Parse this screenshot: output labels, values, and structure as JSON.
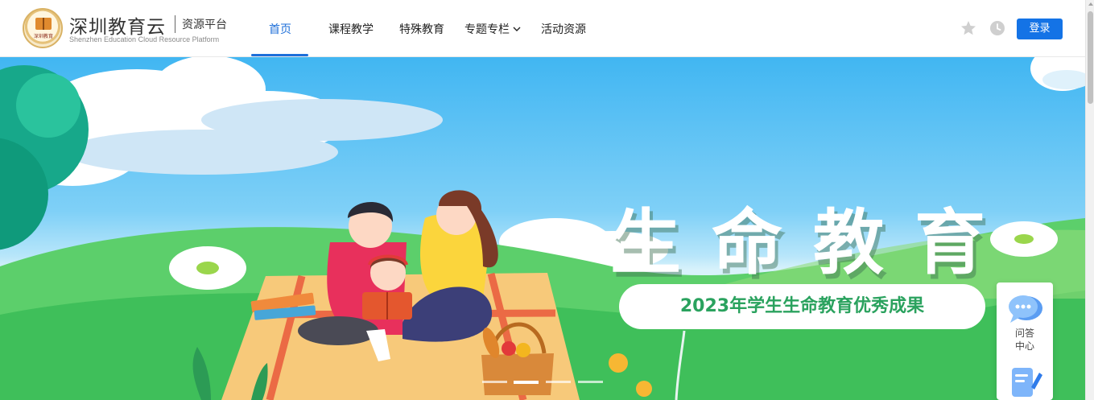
{
  "brand": {
    "name": "深圳教育云",
    "sub": "资源平台",
    "english": "Shenzhen Education Cloud Resource Platform",
    "seal_text": "深圳教育"
  },
  "nav": {
    "items": [
      {
        "label": "首页",
        "active": true
      },
      {
        "label": "课程教学",
        "active": false
      },
      {
        "label": "特殊教育",
        "active": false
      },
      {
        "label": "专题专栏",
        "active": false,
        "has_dropdown": true
      },
      {
        "label": "活动资源",
        "active": false
      }
    ]
  },
  "header_actions": {
    "favorite_icon": "star-icon",
    "history_icon": "clock-icon",
    "login_label": "登录"
  },
  "banner": {
    "title": "生命教育",
    "subtitle": "2023年学生生命教育优秀成果",
    "slide_count": 4,
    "active_slide": 1
  },
  "side_panel": {
    "items": [
      {
        "label": "问答中心",
        "icon": "chat-bubble-icon"
      },
      {
        "label": "",
        "icon": "document-edit-icon"
      }
    ]
  },
  "colors": {
    "accent": "#1e6fd9",
    "login_bg": "#1473e6",
    "subtitle_green": "#2aa25e",
    "sky": "#41b6f2",
    "grass": "#5ccf6b"
  }
}
